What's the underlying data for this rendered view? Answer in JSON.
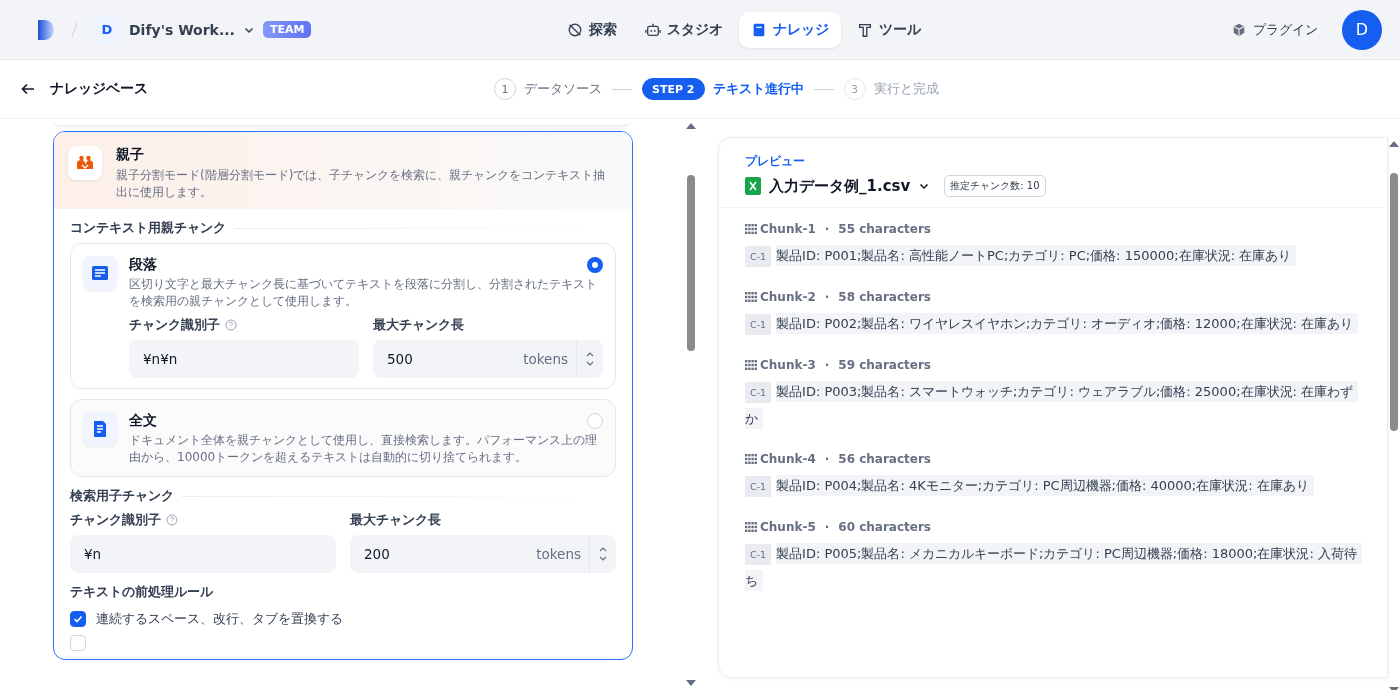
{
  "header": {
    "workspace": {
      "initial": "D",
      "name": "Dify's Work...",
      "badge": "TEAM"
    },
    "nav": [
      {
        "label": "探索",
        "kind": "explore",
        "selected": false
      },
      {
        "label": "スタジオ",
        "kind": "studio",
        "selected": false
      },
      {
        "label": "ナレッジ",
        "kind": "knowledge",
        "selected": true
      },
      {
        "label": "ツール",
        "kind": "tools",
        "selected": false
      }
    ],
    "plugin": "プラグイン",
    "avatar": "D"
  },
  "stepbar": {
    "back_label": "ナレッジベース",
    "steps": [
      {
        "marker": "1",
        "label": "データソース",
        "selected": false,
        "completed": true
      },
      {
        "marker": "STEP 2",
        "label": "テキスト進行中",
        "selected": true
      },
      {
        "marker": "3",
        "label": "実行と完成",
        "selected": false,
        "completed": false
      }
    ]
  },
  "mode": {
    "title": "親子",
    "description": "親子分割モード(階層分割モード)では、子チャンクを検索に、親チャンクをコンテキスト抽出に使用します。",
    "selected": true
  },
  "parent_section": {
    "title": "コンテキスト用親チャンク",
    "options": [
      {
        "kind": "paragraph",
        "title": "段落",
        "description": "区切り文字と最大チャンク長に基づいてテキストを段落に分割し、分割されたテキストを検索用の親チャンクとして使用します。",
        "selected": true,
        "fields": {
          "delimiter_label": "チャンク識別子",
          "delimiter": "¥n¥n",
          "length_label": "最大チャンク長",
          "length": "500",
          "unit": "tokens"
        }
      },
      {
        "kind": "fulltext",
        "title": "全文",
        "description": "ドキュメント全体を親チャンクとして使用し、直接検索します。パフォーマンス上の理由から、10000トークンを超えるテキストは自動的に切り捨てられます。",
        "selected": false
      }
    ]
  },
  "child_section": {
    "title": "検索用子チャンク",
    "delimiter_label": "チャンク識別子",
    "delimiter": "¥n",
    "length_label": "最大チャンク長",
    "length": "200",
    "unit": "tokens"
  },
  "rules": {
    "title": "テキストの前処理ルール",
    "items": [
      {
        "label": "連続するスペース、改行、タブを置換する",
        "checked": true
      },
      {
        "checked": false
      }
    ]
  },
  "preview": {
    "label": "プレビュー",
    "file": "入力データ例_1.csv",
    "estimate": "推定チャンク数: 10",
    "chunks": [
      {
        "title": "Chunk-1",
        "separator": "·",
        "chars": "55 characters",
        "tag": "C-1",
        "text": "製品ID: P001;製品名: 高性能ノートPC;カテゴリ: PC;価格: 150000;在庫状況: 在庫あり"
      },
      {
        "title": "Chunk-2",
        "separator": "·",
        "chars": "58 characters",
        "tag": "C-1",
        "text": "製品ID: P002;製品名: ワイヤレスイヤホン;カテゴリ: オーディオ;価格: 12000;在庫状況: 在庫あり"
      },
      {
        "title": "Chunk-3",
        "separator": "·",
        "chars": "59 characters",
        "tag": "C-1",
        "text": "製品ID: P003;製品名: スマートウォッチ;カテゴリ: ウェアラブル;価格: 25000;在庫状況: 在庫わずか"
      },
      {
        "title": "Chunk-4",
        "separator": "·",
        "chars": "56 characters",
        "tag": "C-1",
        "text": "製品ID: P004;製品名: 4Kモニター;カテゴリ: PC周辺機器;価格: 40000;在庫状況: 在庫あり"
      },
      {
        "title": "Chunk-5",
        "separator": "·",
        "chars": "60 characters",
        "tag": "C-1",
        "text": "製品ID: P005;製品名: メカニカルキーボード;カテゴリ: PC周辺機器;価格: 18000;在庫状況: 入荷待ち"
      }
    ]
  }
}
